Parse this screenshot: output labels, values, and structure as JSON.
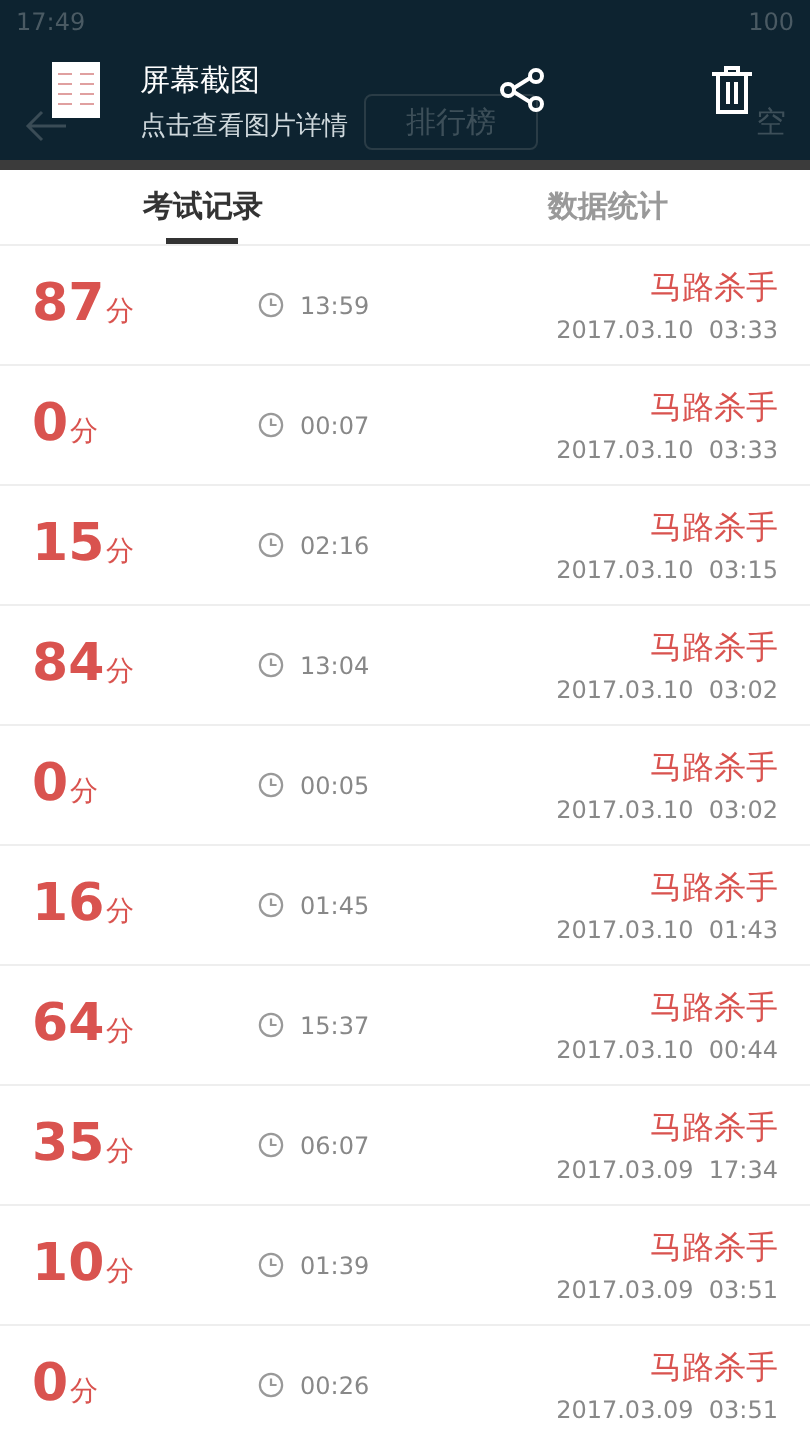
{
  "status_bar": {
    "time": "17:49",
    "battery": "100"
  },
  "notification": {
    "title": "屏幕截图",
    "subtitle": "点击查看图片详情"
  },
  "app_bar": {
    "segment": "排行榜",
    "action": "空"
  },
  "tabs": [
    {
      "label": "考试记录",
      "selected": true
    },
    {
      "label": "数据统计",
      "selected": false
    }
  ],
  "records": [
    {
      "score": "87",
      "unit": "分",
      "duration": "13:59",
      "name": "马路杀手",
      "date": "2017.03.10  03:33"
    },
    {
      "score": "0",
      "unit": "分",
      "duration": "00:07",
      "name": "马路杀手",
      "date": "2017.03.10  03:33"
    },
    {
      "score": "15",
      "unit": "分",
      "duration": "02:16",
      "name": "马路杀手",
      "date": "2017.03.10  03:15"
    },
    {
      "score": "84",
      "unit": "分",
      "duration": "13:04",
      "name": "马路杀手",
      "date": "2017.03.10  03:02"
    },
    {
      "score": "0",
      "unit": "分",
      "duration": "00:05",
      "name": "马路杀手",
      "date": "2017.03.10  03:02"
    },
    {
      "score": "16",
      "unit": "分",
      "duration": "01:45",
      "name": "马路杀手",
      "date": "2017.03.10  01:43"
    },
    {
      "score": "64",
      "unit": "分",
      "duration": "15:37",
      "name": "马路杀手",
      "date": "2017.03.10  00:44"
    },
    {
      "score": "35",
      "unit": "分",
      "duration": "06:07",
      "name": "马路杀手",
      "date": "2017.03.09  17:34"
    },
    {
      "score": "10",
      "unit": "分",
      "duration": "01:39",
      "name": "马路杀手",
      "date": "2017.03.09  03:51"
    },
    {
      "score": "0",
      "unit": "分",
      "duration": "00:26",
      "name": "马路杀手",
      "date": "2017.03.09  03:51"
    }
  ]
}
